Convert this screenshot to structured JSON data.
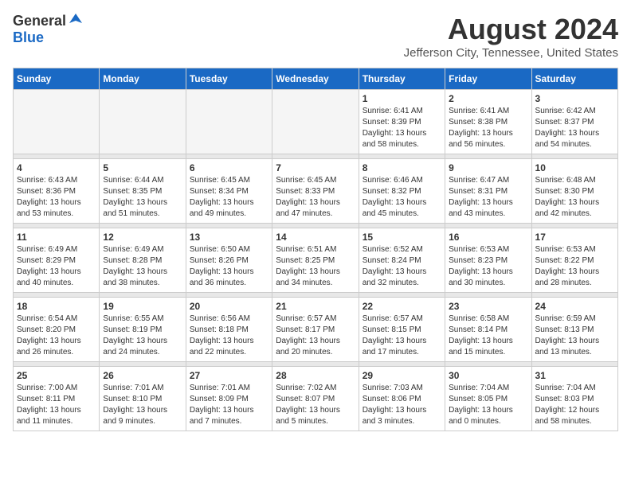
{
  "header": {
    "logo_general": "General",
    "logo_blue": "Blue",
    "month_year": "August 2024",
    "location": "Jefferson City, Tennessee, United States"
  },
  "weekdays": [
    "Sunday",
    "Monday",
    "Tuesday",
    "Wednesday",
    "Thursday",
    "Friday",
    "Saturday"
  ],
  "weeks": [
    [
      {
        "day": "",
        "empty": true
      },
      {
        "day": "",
        "empty": true
      },
      {
        "day": "",
        "empty": true
      },
      {
        "day": "",
        "empty": true
      },
      {
        "day": "1",
        "sunrise": "6:41 AM",
        "sunset": "8:39 PM",
        "daylight": "13 hours and 58 minutes."
      },
      {
        "day": "2",
        "sunrise": "6:41 AM",
        "sunset": "8:38 PM",
        "daylight": "13 hours and 56 minutes."
      },
      {
        "day": "3",
        "sunrise": "6:42 AM",
        "sunset": "8:37 PM",
        "daylight": "13 hours and 54 minutes."
      }
    ],
    [
      {
        "day": "4",
        "sunrise": "6:43 AM",
        "sunset": "8:36 PM",
        "daylight": "13 hours and 53 minutes."
      },
      {
        "day": "5",
        "sunrise": "6:44 AM",
        "sunset": "8:35 PM",
        "daylight": "13 hours and 51 minutes."
      },
      {
        "day": "6",
        "sunrise": "6:45 AM",
        "sunset": "8:34 PM",
        "daylight": "13 hours and 49 minutes."
      },
      {
        "day": "7",
        "sunrise": "6:45 AM",
        "sunset": "8:33 PM",
        "daylight": "13 hours and 47 minutes."
      },
      {
        "day": "8",
        "sunrise": "6:46 AM",
        "sunset": "8:32 PM",
        "daylight": "13 hours and 45 minutes."
      },
      {
        "day": "9",
        "sunrise": "6:47 AM",
        "sunset": "8:31 PM",
        "daylight": "13 hours and 43 minutes."
      },
      {
        "day": "10",
        "sunrise": "6:48 AM",
        "sunset": "8:30 PM",
        "daylight": "13 hours and 42 minutes."
      }
    ],
    [
      {
        "day": "11",
        "sunrise": "6:49 AM",
        "sunset": "8:29 PM",
        "daylight": "13 hours and 40 minutes."
      },
      {
        "day": "12",
        "sunrise": "6:49 AM",
        "sunset": "8:28 PM",
        "daylight": "13 hours and 38 minutes."
      },
      {
        "day": "13",
        "sunrise": "6:50 AM",
        "sunset": "8:26 PM",
        "daylight": "13 hours and 36 minutes."
      },
      {
        "day": "14",
        "sunrise": "6:51 AM",
        "sunset": "8:25 PM",
        "daylight": "13 hours and 34 minutes."
      },
      {
        "day": "15",
        "sunrise": "6:52 AM",
        "sunset": "8:24 PM",
        "daylight": "13 hours and 32 minutes."
      },
      {
        "day": "16",
        "sunrise": "6:53 AM",
        "sunset": "8:23 PM",
        "daylight": "13 hours and 30 minutes."
      },
      {
        "day": "17",
        "sunrise": "6:53 AM",
        "sunset": "8:22 PM",
        "daylight": "13 hours and 28 minutes."
      }
    ],
    [
      {
        "day": "18",
        "sunrise": "6:54 AM",
        "sunset": "8:20 PM",
        "daylight": "13 hours and 26 minutes."
      },
      {
        "day": "19",
        "sunrise": "6:55 AM",
        "sunset": "8:19 PM",
        "daylight": "13 hours and 24 minutes."
      },
      {
        "day": "20",
        "sunrise": "6:56 AM",
        "sunset": "8:18 PM",
        "daylight": "13 hours and 22 minutes."
      },
      {
        "day": "21",
        "sunrise": "6:57 AM",
        "sunset": "8:17 PM",
        "daylight": "13 hours and 20 minutes."
      },
      {
        "day": "22",
        "sunrise": "6:57 AM",
        "sunset": "8:15 PM",
        "daylight": "13 hours and 17 minutes."
      },
      {
        "day": "23",
        "sunrise": "6:58 AM",
        "sunset": "8:14 PM",
        "daylight": "13 hours and 15 minutes."
      },
      {
        "day": "24",
        "sunrise": "6:59 AM",
        "sunset": "8:13 PM",
        "daylight": "13 hours and 13 minutes."
      }
    ],
    [
      {
        "day": "25",
        "sunrise": "7:00 AM",
        "sunset": "8:11 PM",
        "daylight": "13 hours and 11 minutes."
      },
      {
        "day": "26",
        "sunrise": "7:01 AM",
        "sunset": "8:10 PM",
        "daylight": "13 hours and 9 minutes."
      },
      {
        "day": "27",
        "sunrise": "7:01 AM",
        "sunset": "8:09 PM",
        "daylight": "13 hours and 7 minutes."
      },
      {
        "day": "28",
        "sunrise": "7:02 AM",
        "sunset": "8:07 PM",
        "daylight": "13 hours and 5 minutes."
      },
      {
        "day": "29",
        "sunrise": "7:03 AM",
        "sunset": "8:06 PM",
        "daylight": "13 hours and 3 minutes."
      },
      {
        "day": "30",
        "sunrise": "7:04 AM",
        "sunset": "8:05 PM",
        "daylight": "13 hours and 0 minutes."
      },
      {
        "day": "31",
        "sunrise": "7:04 AM",
        "sunset": "8:03 PM",
        "daylight": "12 hours and 58 minutes."
      }
    ]
  ]
}
